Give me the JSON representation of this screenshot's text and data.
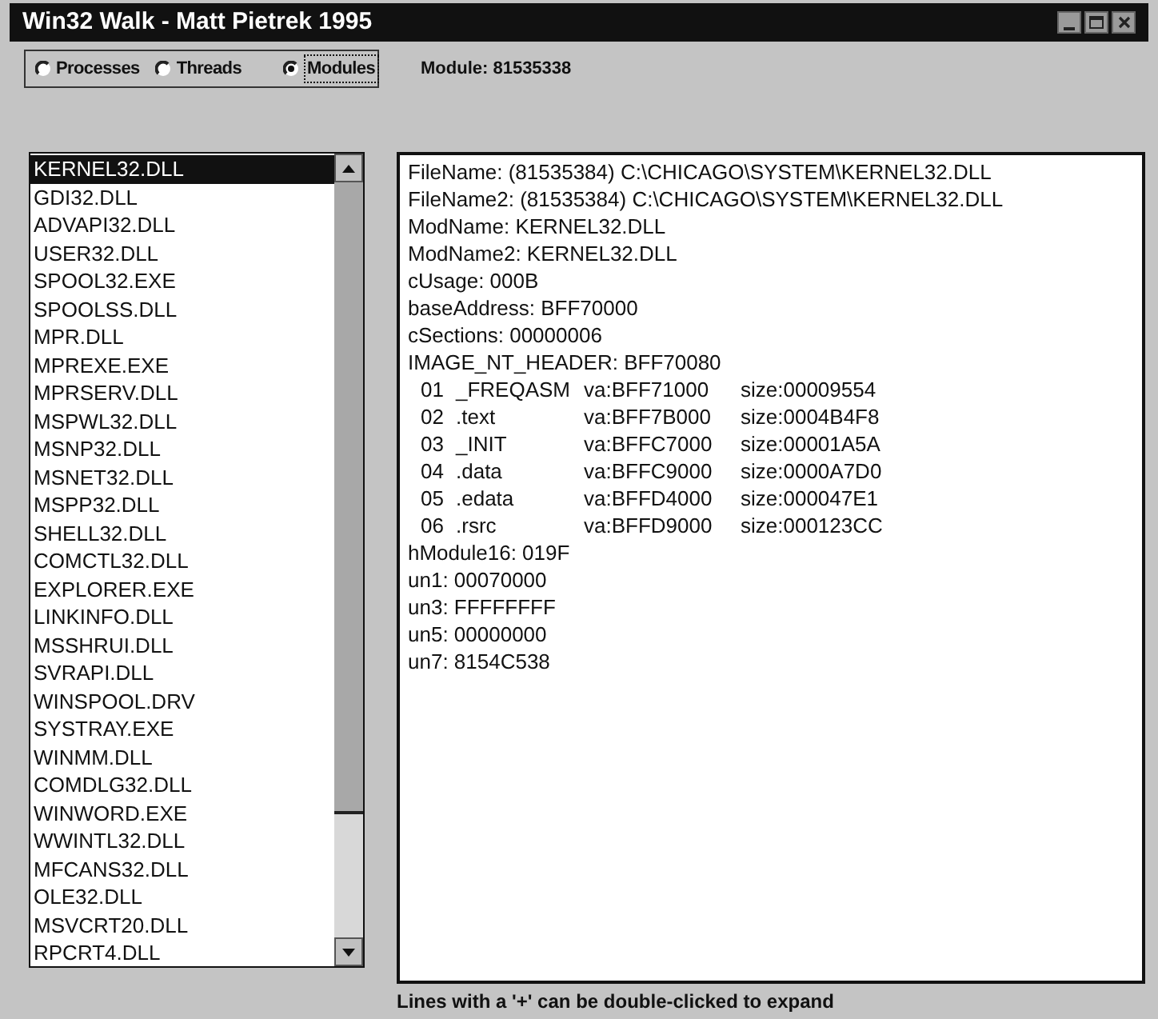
{
  "window": {
    "title": "Win32 Walk - Matt Pietrek 1995"
  },
  "view_options": [
    {
      "label": "Processes",
      "selected": false
    },
    {
      "label": "Threads",
      "selected": false
    },
    {
      "label": "Modules",
      "selected": true
    }
  ],
  "module_label": "Module: 81535338",
  "modules": [
    {
      "name": "KERNEL32.DLL",
      "selected": true
    },
    {
      "name": "GDI32.DLL",
      "selected": false
    },
    {
      "name": "ADVAPI32.DLL",
      "selected": false
    },
    {
      "name": "USER32.DLL",
      "selected": false
    },
    {
      "name": "SPOOL32.EXE",
      "selected": false
    },
    {
      "name": "SPOOLSS.DLL",
      "selected": false
    },
    {
      "name": "MPR.DLL",
      "selected": false
    },
    {
      "name": "MPREXE.EXE",
      "selected": false
    },
    {
      "name": "MPRSERV.DLL",
      "selected": false
    },
    {
      "name": "MSPWL32.DLL",
      "selected": false
    },
    {
      "name": "MSNP32.DLL",
      "selected": false
    },
    {
      "name": "MSNET32.DLL",
      "selected": false
    },
    {
      "name": "MSPP32.DLL",
      "selected": false
    },
    {
      "name": "SHELL32.DLL",
      "selected": false
    },
    {
      "name": "COMCTL32.DLL",
      "selected": false
    },
    {
      "name": "EXPLORER.EXE",
      "selected": false
    },
    {
      "name": "LINKINFO.DLL",
      "selected": false
    },
    {
      "name": "MSSHRUI.DLL",
      "selected": false
    },
    {
      "name": "SVRAPI.DLL",
      "selected": false
    },
    {
      "name": "WINSPOOL.DRV",
      "selected": false
    },
    {
      "name": "SYSTRAY.EXE",
      "selected": false
    },
    {
      "name": "WINMM.DLL",
      "selected": false
    },
    {
      "name": "COMDLG32.DLL",
      "selected": false
    },
    {
      "name": "WINWORD.EXE",
      "selected": false
    },
    {
      "name": "WWINTL32.DLL",
      "selected": false
    },
    {
      "name": "MFCANS32.DLL",
      "selected": false
    },
    {
      "name": "OLE32.DLL",
      "selected": false
    },
    {
      "name": "MSVCRT20.DLL",
      "selected": false
    },
    {
      "name": "RPCRT4.DLL",
      "selected": false
    }
  ],
  "details": [
    {
      "kind": "text",
      "text": "FileName: (81535384) C:\\CHICAGO\\SYSTEM\\KERNEL32.DLL"
    },
    {
      "kind": "text",
      "text": "FileName2: (81535384) C:\\CHICAGO\\SYSTEM\\KERNEL32.DLL"
    },
    {
      "kind": "text",
      "text": "ModName: KERNEL32.DLL"
    },
    {
      "kind": "text",
      "text": "ModName2: KERNEL32.DLL"
    },
    {
      "kind": "text",
      "text": "cUsage: 000B"
    },
    {
      "kind": "text",
      "text": "baseAddress: BFF70000"
    },
    {
      "kind": "text",
      "text": "cSections: 00000006"
    },
    {
      "kind": "text",
      "text": "IMAGE_NT_HEADER: BFF70080"
    },
    {
      "kind": "section",
      "number": "01",
      "name": "_FREQASM",
      "va": "va:BFF71000",
      "size": "size:00009554"
    },
    {
      "kind": "section",
      "number": "02",
      "name": ".text",
      "va": "va:BFF7B000",
      "size": "size:0004B4F8"
    },
    {
      "kind": "section",
      "number": "03",
      "name": "_INIT",
      "va": "va:BFFC7000",
      "size": "size:00001A5A"
    },
    {
      "kind": "section",
      "number": "04",
      "name": ".data",
      "va": "va:BFFC9000",
      "size": "size:0000A7D0"
    },
    {
      "kind": "section",
      "number": "05",
      "name": ".edata",
      "va": "va:BFFD4000",
      "size": "size:000047E1"
    },
    {
      "kind": "section",
      "number": "06",
      "name": ".rsrc",
      "va": "va:BFFD9000",
      "size": "size:000123CC"
    },
    {
      "kind": "text",
      "text": "hModule16: 019F"
    },
    {
      "kind": "text",
      "text": "un1: 00070000"
    },
    {
      "kind": "text",
      "text": "un3: FFFFFFFF"
    },
    {
      "kind": "text",
      "text": "un5: 00000000"
    },
    {
      "kind": "text",
      "text": "un7: 8154C538"
    }
  ],
  "hint": "Lines with a '+' can be double-clicked to expand"
}
